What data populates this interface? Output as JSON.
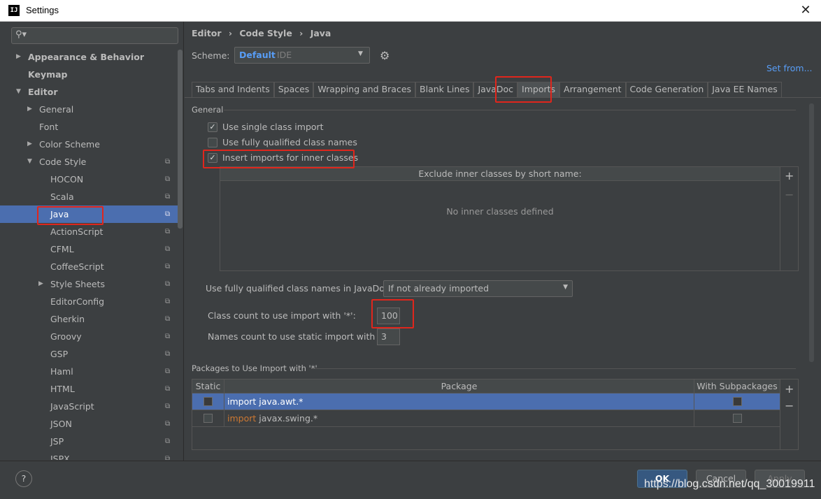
{
  "window": {
    "title": "Settings",
    "app_icon": "IJ"
  },
  "sidebar": {
    "search_placeholder": "",
    "items": [
      {
        "label": "Appearance & Behavior",
        "bold": true
      },
      {
        "label": "Keymap",
        "bold": true
      },
      {
        "label": "Editor",
        "bold": true
      },
      {
        "label": "General"
      },
      {
        "label": "Font"
      },
      {
        "label": "Color Scheme"
      },
      {
        "label": "Code Style"
      },
      {
        "label": "HOCON"
      },
      {
        "label": "Scala"
      },
      {
        "label": "Java",
        "selected": true
      },
      {
        "label": "ActionScript"
      },
      {
        "label": "CFML"
      },
      {
        "label": "CoffeeScript"
      },
      {
        "label": "Style Sheets"
      },
      {
        "label": "EditorConfig"
      },
      {
        "label": "Gherkin"
      },
      {
        "label": "Groovy"
      },
      {
        "label": "GSP"
      },
      {
        "label": "Haml"
      },
      {
        "label": "HTML"
      },
      {
        "label": "JavaScript"
      },
      {
        "label": "JSON"
      },
      {
        "label": "JSP"
      },
      {
        "label": "JSPX"
      }
    ]
  },
  "breadcrumb": [
    "Editor",
    "›",
    "Code Style",
    "›",
    "Java"
  ],
  "scheme": {
    "label": "Scheme:",
    "name": "Default",
    "type": "IDE",
    "set_from": "Set from..."
  },
  "tabs": [
    "Tabs and Indents",
    "Spaces",
    "Wrapping and Braces",
    "Blank Lines",
    "JavaDoc",
    "Imports",
    "Arrangement",
    "Code Generation",
    "Java EE Names"
  ],
  "active_tab": "Imports",
  "general": {
    "title": "General",
    "checkboxes": [
      {
        "label": "Use single class import",
        "checked": true
      },
      {
        "label": "Use fully qualified class names",
        "checked": false
      },
      {
        "label": "Insert imports for inner classes",
        "checked": true
      }
    ],
    "exclude_header": "Exclude inner classes by short name:",
    "exclude_empty": "No inner classes defined",
    "javadoc_label": "Use fully qualified class names in JavaDoc:",
    "javadoc_value": "If not already imported",
    "class_count_label": "Class count to use import with '*':",
    "class_count_value": "100",
    "names_count_label": "Names count to use static import with '*':",
    "names_count_value": "3"
  },
  "packages": {
    "title": "Packages to Use Import with '*'",
    "headers": [
      "Static",
      "Package",
      "With Subpackages"
    ],
    "rows": [
      {
        "static": false,
        "package": "import java.awt.*",
        "subpackages": false,
        "selected": true
      },
      {
        "static": false,
        "keyword": "import",
        "package": " javax.swing.*",
        "subpackages": false,
        "selected": false
      }
    ]
  },
  "buttons": {
    "help": "?",
    "ok": "OK",
    "cancel": "Cancel",
    "apply": "Apply"
  },
  "watermark": "https://blog.csdn.net/qq_30019911",
  "colors": {
    "selection": "#4b6eaf",
    "link": "#589df6",
    "highlight": "#e0261c",
    "keyword": "#cc7832"
  }
}
